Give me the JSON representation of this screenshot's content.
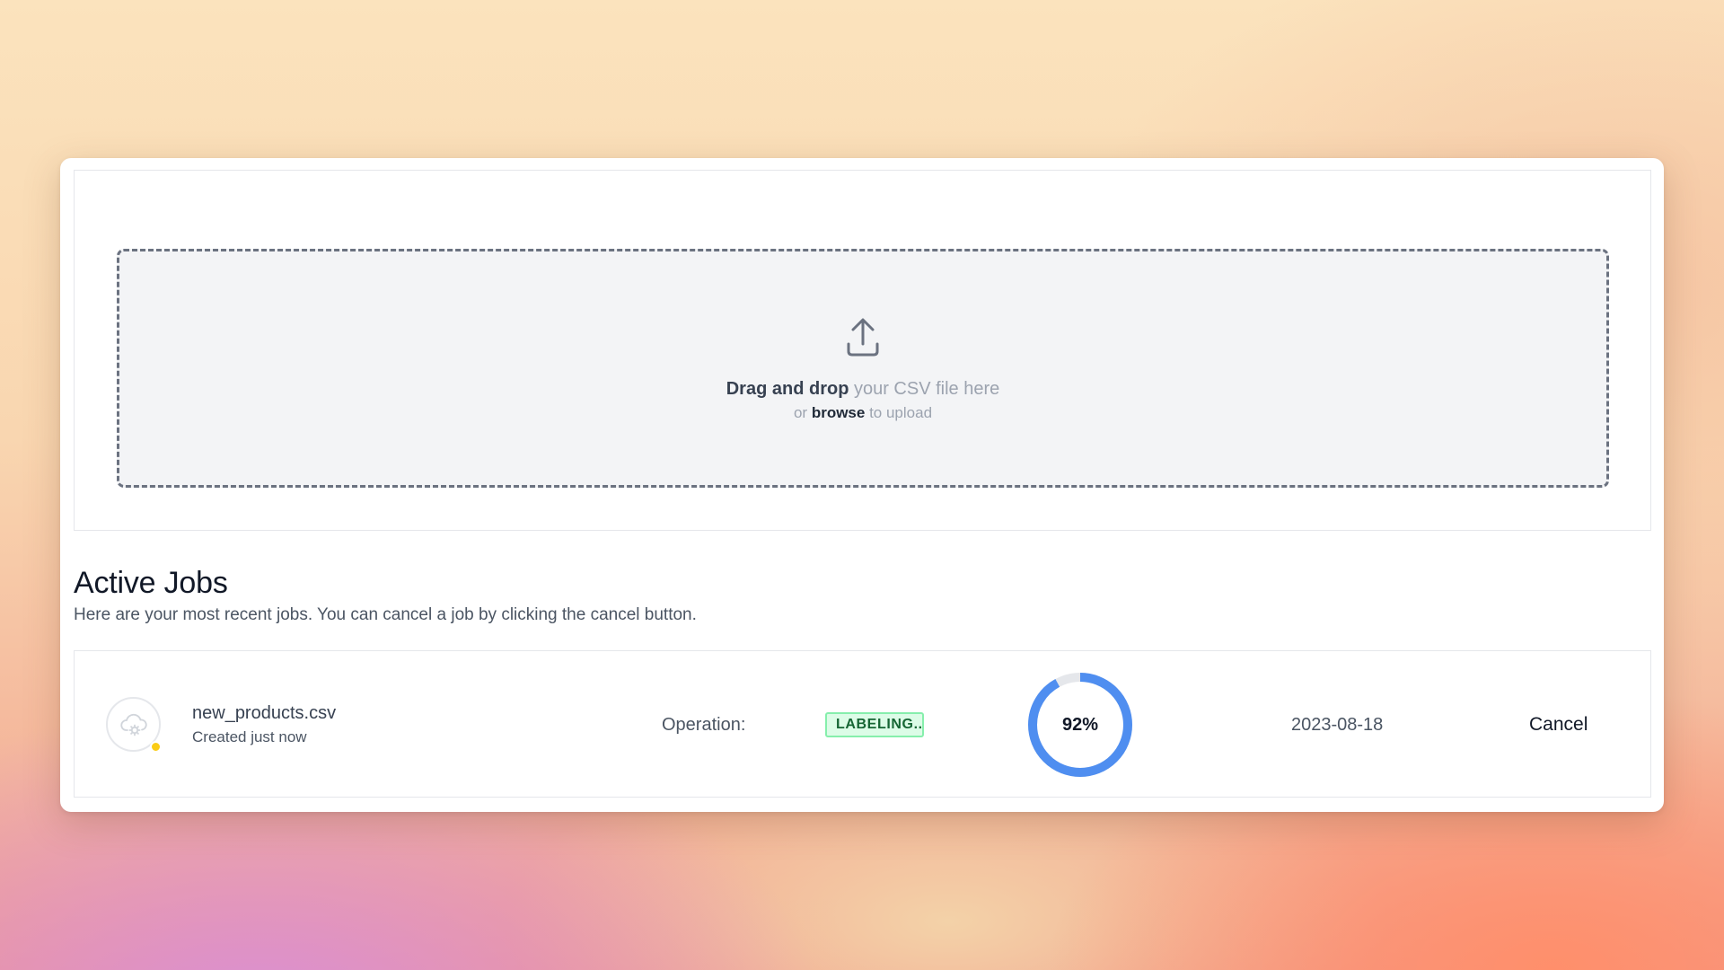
{
  "upload": {
    "icon": "upload-icon",
    "drag_strong": "Drag and drop",
    "drag_rest": " your CSV file here",
    "or_text": "or ",
    "browse_label": "browse",
    "to_upload": " to upload"
  },
  "jobs": {
    "title": "Active Jobs",
    "description": "Here are your most recent jobs. You can cancel a job by clicking the cancel button.",
    "items": [
      {
        "icon": "cloud-gear-icon",
        "status_color": "#facc15",
        "file_name": "new_products.csv",
        "created": "Created just now",
        "operation_label": "Operation:",
        "operation": "LABELING...",
        "progress_percent": 92,
        "progress_text": "92%",
        "progress_color": "#4f8ef0",
        "date": "2023-08-18",
        "cancel_label": "Cancel"
      }
    ]
  }
}
